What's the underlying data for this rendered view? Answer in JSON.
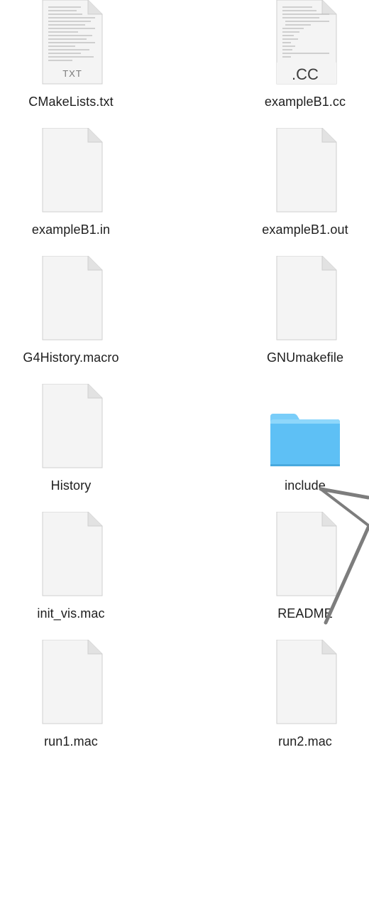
{
  "files": [
    {
      "name": "CMakeLists.txt",
      "icon": "txt-document-icon",
      "badge": "TXT"
    },
    {
      "name": "exampleB1.cc",
      "icon": "cc-source-file-icon",
      "badge": ".CC"
    },
    {
      "name": "exampleB1.in",
      "icon": "blank-document-icon"
    },
    {
      "name": "exampleB1.out",
      "icon": "blank-document-icon"
    },
    {
      "name": "G4History.macro",
      "icon": "blank-document-icon"
    },
    {
      "name": "GNUmakefile",
      "icon": "blank-document-icon"
    },
    {
      "name": "History",
      "icon": "blank-document-icon"
    },
    {
      "name": "include",
      "icon": "folder-icon"
    },
    {
      "name": "init_vis.mac",
      "icon": "blank-document-icon"
    },
    {
      "name": "README",
      "icon": "blank-document-icon"
    },
    {
      "name": "run1.mac",
      "icon": "blank-document-icon"
    },
    {
      "name": "run2.mac",
      "icon": "blank-document-icon"
    }
  ],
  "colors": {
    "folder": "#5ec0f5",
    "folder_tab": "#7fd0fa",
    "label": "#1e1e1e",
    "arrow": "#7d7d7d"
  }
}
